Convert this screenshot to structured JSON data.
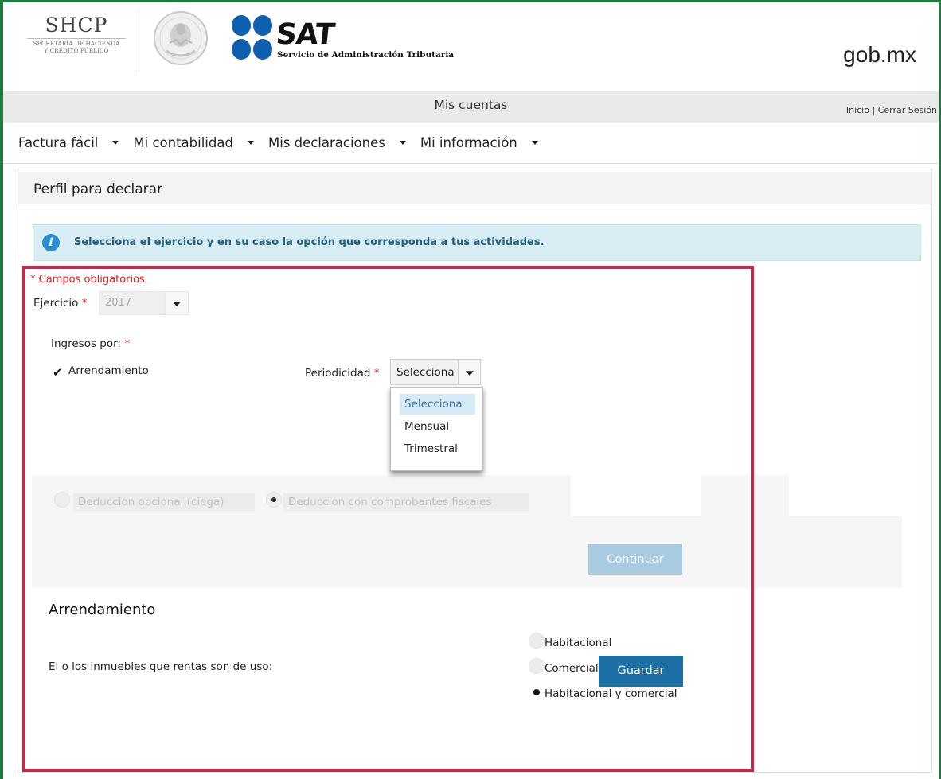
{
  "header": {
    "shcp_title": "SHCP",
    "shcp_sub_1": "SECRETARÍA DE HACIENDA",
    "shcp_sub_2": "Y CRÉDITO PÚBLICO",
    "sat_word": "SAT",
    "sat_sub": "Servicio de Administración Tributaria",
    "gob_logo": "gob.mx"
  },
  "topbar": {
    "title": "Mis cuentas",
    "link_inicio": "Inicio",
    "separator": "|",
    "link_cerrar": "Cerrar Sesión"
  },
  "nav": {
    "items": [
      {
        "label": "Factura fácil"
      },
      {
        "label": "Mi contabilidad"
      },
      {
        "label": "Mis declaraciones"
      },
      {
        "label": "Mi información"
      }
    ]
  },
  "panel": {
    "title": "Perfil para declarar",
    "info_text": "Selecciona el ejercicio y en su caso la opción que corresponda a tus actividades."
  },
  "form": {
    "required_note": "* Campos obligatorios",
    "ejercicio_label": "Ejercicio",
    "ejercicio_value": "2017",
    "ingresos_label": "Ingresos por:",
    "required_mark": "*",
    "arrendamiento_checkbox_label": "Arrendamiento",
    "periodicidad_label": "Periodicidad",
    "periodicidad_value": "Selecciona",
    "periodicidad_options": [
      "Selecciona",
      "Mensual",
      "Trimestral"
    ],
    "deduccion_opcional": "Deducción opcional (ciega)",
    "deduccion_comprobantes": "Deducción con comprobantes fiscales",
    "continue_label": "Continuar",
    "section_title": "Arrendamiento",
    "uso_question": "El o los inmuebles que rentas son de uso:",
    "uso_options": [
      "Habitacional",
      "Comercial",
      "Habitacional y comercial"
    ],
    "uso_selected": "Habitacional y comercial",
    "save_label": "Guardar"
  },
  "colors": {
    "frame_green": "#1e7a3c",
    "highlight_red": "#c12a4a",
    "primary_blue": "#1c6fa4",
    "info_bg": "#d9edf5"
  }
}
